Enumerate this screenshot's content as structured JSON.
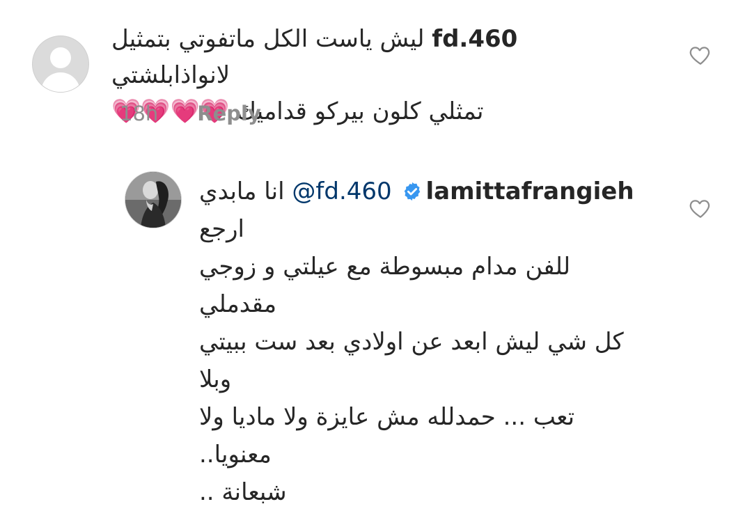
{
  "comment1": {
    "username": "fd.460",
    "line1_text": "ليش ياست الكل ماتفوتي بتمثيل لانواذابلشتي",
    "line2_text": "تمثلي كلون بيركو قداميك",
    "hearts": "💗💗💗💗",
    "time": "18h",
    "reply_label": "Reply"
  },
  "comment2": {
    "username": "lamittafrangieh",
    "mention": "@fd.460",
    "line1_text": "انا مابدي ارجع",
    "line2": "للفن مدام مبسوطة مع عيلتي و زوجي مقدملي",
    "line3": "كل شي ليش ابعد عن اولادي بعد ست ببيتي وبلا",
    "line4": "تعب ... حمدلله مش عايزة ولا ماديا ولا معنويا..",
    "line5": "شبعانة .."
  },
  "icons": {
    "like": "heart-outline-icon",
    "verified": "verified-badge-icon"
  },
  "colors": {
    "text": "#262626",
    "meta": "#8e8e8e",
    "mention": "#00376b",
    "verified": "#3897f0",
    "avatar_placeholder": "#dbdbdb"
  }
}
